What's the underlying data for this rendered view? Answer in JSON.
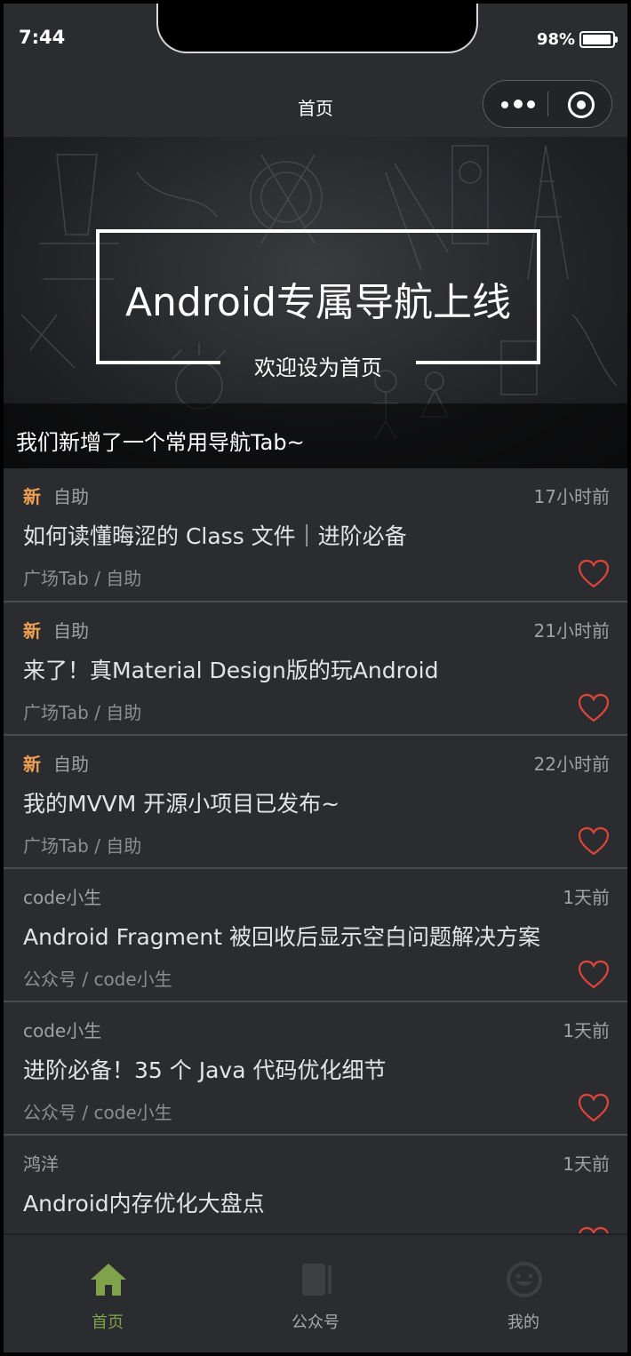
{
  "status_bar": {
    "time": "7:44",
    "battery": "98%"
  },
  "nav": {
    "title": "首页"
  },
  "banner": {
    "headline": "Android专属导航上线",
    "subline": "欢迎设为首页",
    "caption": "我们新增了一个常用导航Tab~"
  },
  "articles": [
    {
      "badge": "新",
      "author": "自助",
      "time": "17小时前",
      "title": "如何读懂晦涩的 Class 文件｜进阶必备",
      "category": "广场Tab / 自助"
    },
    {
      "badge": "新",
      "author": "自助",
      "time": "21小时前",
      "title": "来了！真Material Design版的玩Android",
      "category": "广场Tab / 自助"
    },
    {
      "badge": "新",
      "author": "自助",
      "time": "22小时前",
      "title": "我的MVVM 开源小项目已发布~",
      "category": "广场Tab / 自助"
    },
    {
      "badge": "",
      "author": "code小生",
      "time": "1天前",
      "title": "Android Fragment 被回收后显示空白问题解决方案",
      "category": "公众号 / code小生"
    },
    {
      "badge": "",
      "author": "code小生",
      "time": "1天前",
      "title": "进阶必备！35 个 Java 代码优化细节",
      "category": "公众号 / code小生"
    },
    {
      "badge": "",
      "author": "鸿洋",
      "time": "1天前",
      "title": "Android内存优化大盘点",
      "category": ""
    }
  ],
  "tabbar": {
    "home": "首页",
    "official": "公众号",
    "mine": "我的"
  },
  "colors": {
    "background": "#2b2c30",
    "new_badge": "#f0a050",
    "heart": "#e0443a",
    "tab_active": "#7fa24a"
  },
  "icons": [
    "more-dots-icon",
    "close-target-icon",
    "heart-outline-icon",
    "home-icon",
    "book-icon",
    "smiley-icon"
  ]
}
